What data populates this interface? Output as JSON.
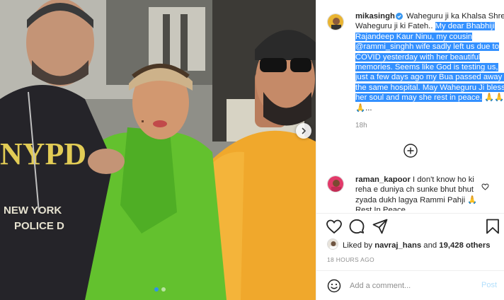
{
  "post": {
    "author": "mikasingh",
    "caption_plain": "Waheguru ji ka Khalsa Shree Waheguru ji ki Fateh..",
    "caption_highlighted": "My dear Bhabhiji Rajandeep Kaur Ninu, my cousin @rammi_singhh wife sadly left us due to COVID yesterday with her beautiful memories. Seems like God is testing us, just a few days ago my Bua passed away in the same hospital. May Waheguru Ji bless her soul and may she rest in peace.",
    "caption_emoji": "🙏🙏🙏...",
    "caption_time": "18h",
    "carousel": {
      "current": 1,
      "total": 2
    }
  },
  "comment": {
    "username": "raman_kapoor",
    "text": "I don't know ho ki reha e duniya ch sunke bhut bhut zyada dukh lagya Rammi Pahji 🙏 Rest In Peace"
  },
  "likes": {
    "prefix": "Liked by",
    "user": "navraj_hans",
    "connector": "and",
    "count": "19,428 others"
  },
  "post_age": "18 HOURS AGO",
  "add_comment": {
    "placeholder": "Add a comment...",
    "post_label": "Post"
  },
  "icons": {
    "verified": "verified-badge-icon",
    "add": "plus-circle-icon",
    "like": "heart-icon",
    "comment": "comment-bubble-icon",
    "share": "paper-plane-icon",
    "save": "bookmark-icon",
    "emoji": "smiley-icon",
    "next": "chevron-right-icon"
  },
  "colors": {
    "highlight": "#3390ff",
    "verified": "#3897f0",
    "post_button": "#b2dffc",
    "active_dot": "#2f93ea"
  }
}
